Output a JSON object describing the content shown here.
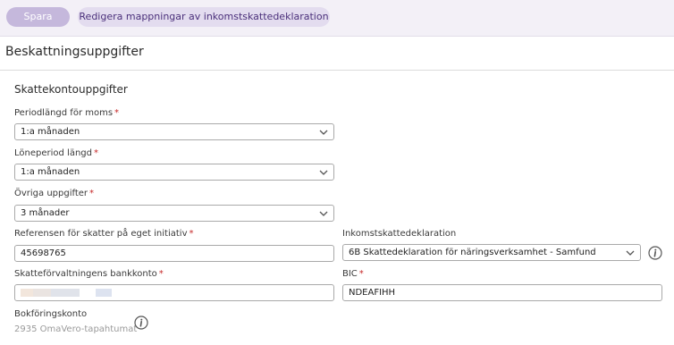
{
  "toolbar": {
    "save_label": "Spara",
    "edit_mappings_label": "Redigera mappningar av inkomstskattedeklaration"
  },
  "page": {
    "title": "Beskattningsuppgifter",
    "section_title": "Skattekontouppgifter"
  },
  "fields": {
    "vat_period": {
      "label": "Periodlängd för moms",
      "required_mark": "*",
      "value": "1:a månaden"
    },
    "payroll_period": {
      "label": "Löneperiod längd",
      "required_mark": "*",
      "value": "1:a månaden"
    },
    "other_info": {
      "label": "Övriga uppgifter",
      "required_mark": "*",
      "value": "3 månader"
    },
    "own_tax_reference": {
      "label": "Referensen för skatter på eget initiativ",
      "required_mark": "*",
      "value": "45698765"
    },
    "income_tax_declaration": {
      "label": "Inkomstskattedeklaration",
      "value": "6B Skattedeklaration för näringsverksamhet - Samfund"
    },
    "tax_bank_account": {
      "label": "Skatteförvaltningens bankkonto",
      "required_mark": "*",
      "value": ""
    },
    "bic": {
      "label": "BIC",
      "required_mark": "*",
      "value": "NDEAFIHH"
    },
    "bookkeeping_account": {
      "label": "Bokföringskonto",
      "value": "2935 OmaVero-tapahtumat"
    }
  },
  "icons": {
    "chevron": "chevron-down-icon",
    "info": "info-icon"
  },
  "colors": {
    "toolbar_bg": "#f3f0f7",
    "primary_disabled": "#c5b8dc",
    "secondary_button": "#e3dcef",
    "secondary_text": "#4a2f7a",
    "required": "#c62828"
  }
}
